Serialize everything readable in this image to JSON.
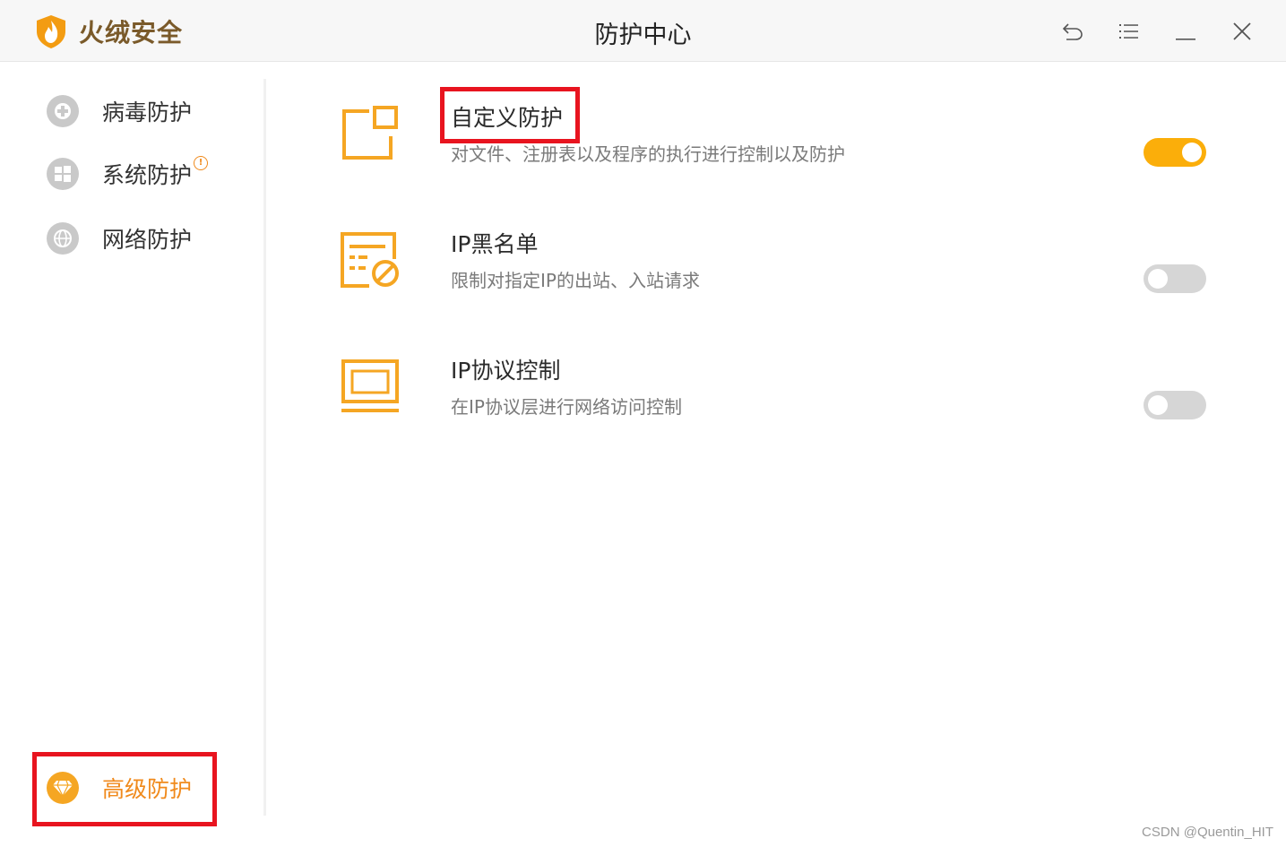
{
  "app": {
    "brand_name": "火绒安全",
    "window_title": "防护中心"
  },
  "window_controls": [
    {
      "name": "back-icon"
    },
    {
      "name": "menu-icon"
    },
    {
      "name": "minimize-icon"
    },
    {
      "name": "close-icon"
    }
  ],
  "sidebar": {
    "items": [
      {
        "label": "病毒防护",
        "icon": "plus-shield-icon"
      },
      {
        "label": "系统防护",
        "icon": "windows-icon",
        "badge": "!"
      },
      {
        "label": "网络防护",
        "icon": "globe-icon"
      }
    ],
    "advanced": {
      "label": "高级防护",
      "icon": "diamond-icon"
    }
  },
  "features": [
    {
      "title": "自定义防护",
      "desc": "对文件、注册表以及程序的执行进行控制以及防护",
      "enabled": true,
      "icon": "custom-rule-icon"
    },
    {
      "title": "IP黑名单",
      "desc": "限制对指定IP的出站、入站请求",
      "enabled": false,
      "icon": "blacklist-icon"
    },
    {
      "title": "IP协议控制",
      "desc": "在IP协议层进行网络访问控制",
      "enabled": false,
      "icon": "protocol-monitor-icon"
    }
  ],
  "colors": {
    "accent": "#fbae0a",
    "accent_text": "#f08a1c",
    "highlight": "#e8141f",
    "toggle_off": "#d6d6d6"
  },
  "watermark": "CSDN @Quentin_HIT"
}
